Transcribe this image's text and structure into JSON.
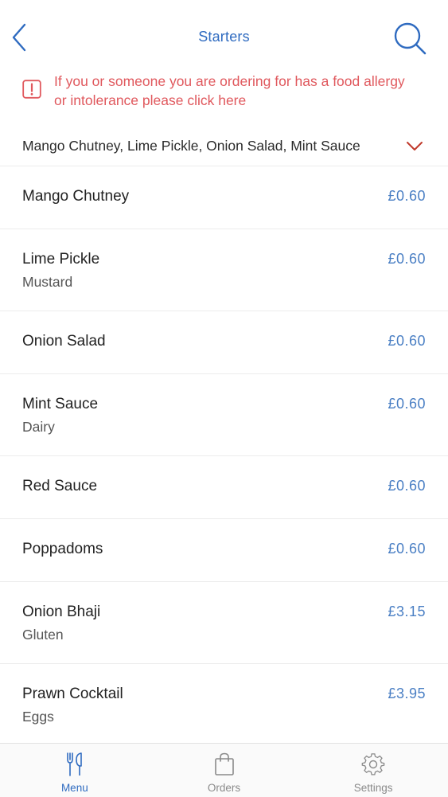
{
  "header": {
    "title": "Starters",
    "back_icon": "chevron-left-icon",
    "search_icon": "search-icon"
  },
  "allergy_notice": {
    "text": "If you or someone you are ordering for has a food allergy or intolerance please click here",
    "icon": "alert-icon",
    "color": "#e0585d"
  },
  "filter": {
    "text": "Mango Chutney, Lime Pickle, Onion Salad, Mint Sauce",
    "icon": "chevron-down-icon"
  },
  "items": [
    {
      "name": "Mango Chutney",
      "price": "£0.60",
      "sub": ""
    },
    {
      "name": "Lime Pickle",
      "price": "£0.60",
      "sub": "Mustard"
    },
    {
      "name": "Onion Salad",
      "price": "£0.60",
      "sub": ""
    },
    {
      "name": "Mint Sauce",
      "price": "£0.60",
      "sub": "Dairy"
    },
    {
      "name": "Red Sauce",
      "price": "£0.60",
      "sub": ""
    },
    {
      "name": "Poppadoms",
      "price": "£0.60",
      "sub": ""
    },
    {
      "name": "Onion Bhaji",
      "price": "£3.15",
      "sub": "Gluten"
    },
    {
      "name": "Prawn Cocktail",
      "price": "£3.95",
      "sub": "Eggs"
    }
  ],
  "tabs": [
    {
      "label": "Menu",
      "icon": "fork-knife-icon",
      "active": true
    },
    {
      "label": "Orders",
      "icon": "shopping-bag-icon",
      "active": false
    },
    {
      "label": "Settings",
      "icon": "gear-icon",
      "active": false
    }
  ],
  "colors": {
    "accent": "#2f6bc0",
    "price": "#4a7fc4",
    "alert": "#e0585d"
  }
}
